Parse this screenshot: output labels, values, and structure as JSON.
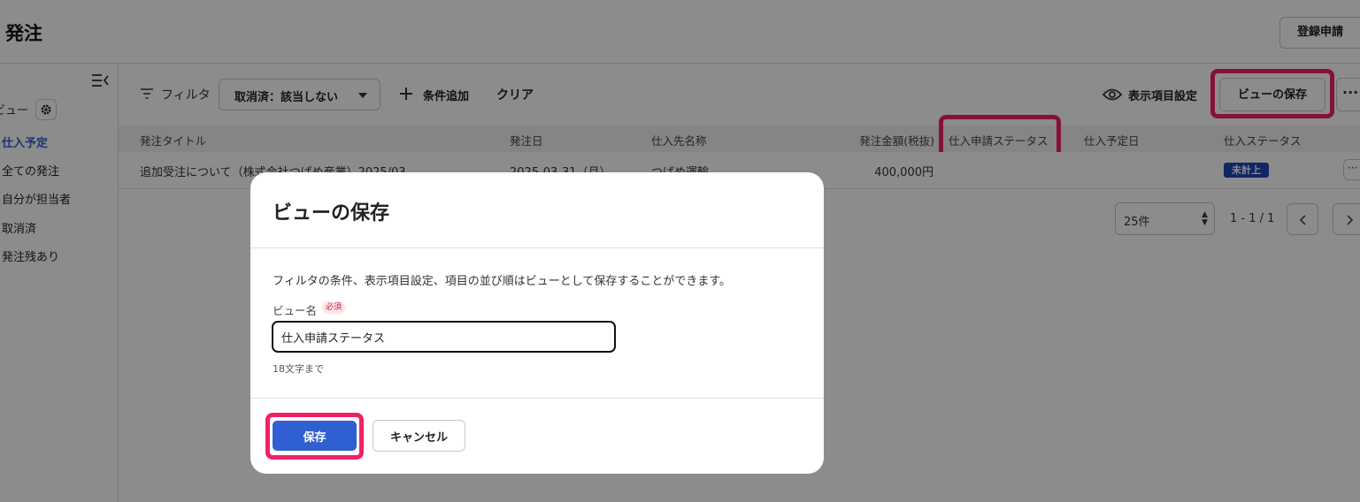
{
  "header": {
    "title": "発注",
    "register_label": "登録申請"
  },
  "sidebar": {
    "view_label": "ビュー",
    "view_label_visible": "ビュー",
    "items": [
      {
        "label": "仕入予定",
        "active": true
      },
      {
        "label": "全ての発注",
        "active": false
      },
      {
        "label": "自分が担当者",
        "active": false
      },
      {
        "label": "取消済",
        "active": false
      },
      {
        "label": "発注残あり",
        "active": false
      }
    ]
  },
  "toolbar": {
    "filter_label": "フィルタ",
    "filter_chip": "取消済：該当しない",
    "add_condition": "条件追加",
    "clear": "クリア",
    "display_settings": "表示項目設定",
    "save_view": "ビューの保存",
    "more": "···"
  },
  "table": {
    "columns": [
      "発注タイトル",
      "発注日",
      "仕入先名称",
      "発注金額(税抜)",
      "仕入申請ステータス",
      "仕入予定日",
      "仕入ステータス"
    ],
    "rows": [
      {
        "title": "追加受注について（株式会社つばめ産業）2025/03",
        "date": "2025-03-31（月）",
        "supplier": "つばめ運輸",
        "amount": "400,000円",
        "apply_status": "",
        "planned_date": "",
        "status": "未計上"
      }
    ]
  },
  "pagination": {
    "per_page": "25件",
    "range": "1 - 1 / 1"
  },
  "modal": {
    "title": "ビューの保存",
    "description": "フィルタの条件、表示項目設定、項目の並び順はビューとして保存することができます。",
    "field_label": "ビュー名",
    "required_badge": "必須",
    "input_value": "仕入申請ステータス",
    "help_text": "18文字まで",
    "save_label": "保存",
    "cancel_label": "キャンセル"
  },
  "colors": {
    "accent": "#2f5fd0",
    "highlight": "#f0206c",
    "badge": "#1f47b5"
  }
}
